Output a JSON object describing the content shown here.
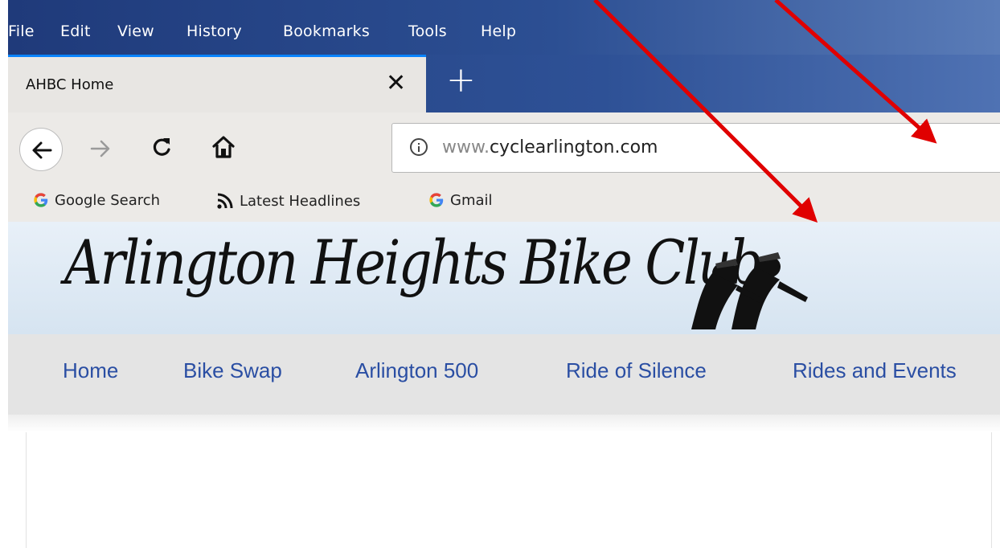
{
  "menu": [
    {
      "label": "File"
    },
    {
      "label": "Edit"
    },
    {
      "label": "View"
    },
    {
      "label": "History"
    },
    {
      "label": "Bookmarks"
    },
    {
      "label": "Tools"
    },
    {
      "label": "Help"
    }
  ],
  "tab": {
    "title": "AHBC Home",
    "close_glyph": "✕",
    "new_tab_glyph": "+"
  },
  "nav": {
    "back_icon": "back-arrow-icon",
    "forward_icon": "forward-arrow-icon",
    "reload_icon": "reload-icon",
    "home_icon": "home-icon"
  },
  "url": {
    "prefix": "www.",
    "domain": "cyclearlington.com"
  },
  "bookmarks": [
    {
      "label": "Google Search",
      "icon": "google-icon"
    },
    {
      "label": "Latest Headlines",
      "icon": "rss-icon"
    },
    {
      "label": "Gmail",
      "icon": "google-icon"
    }
  ],
  "site": {
    "title": "Arlington Heights Bike Club",
    "nav": [
      "Home",
      "Bike Swap",
      "Arlington 500",
      "Ride of Silence",
      "Rides and Events"
    ]
  },
  "colors": {
    "annotation_arrow": "#e00000",
    "site_link": "#2a4ea3",
    "menubar": "#2c4f93"
  }
}
